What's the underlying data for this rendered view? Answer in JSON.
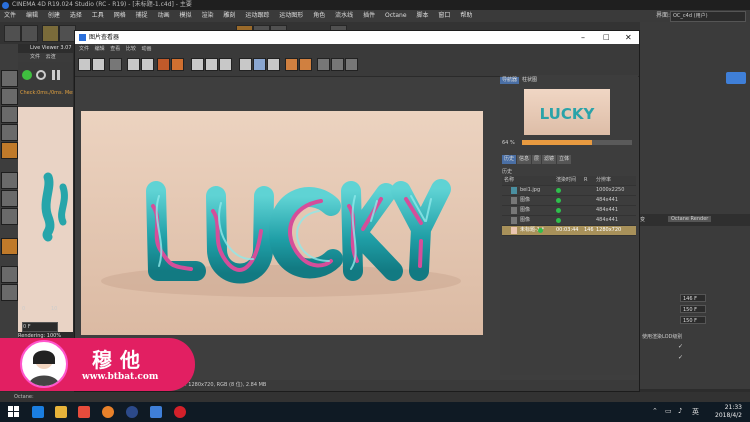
{
  "app": {
    "title": "CINEMA 4D R19.024 Studio (RC - R19) - [未标题-1.c4d] - 主要",
    "layout_label": "界面:",
    "layout_value": "OC_c4d (用户)"
  },
  "menubar": [
    "文件",
    "编辑",
    "创建",
    "选择",
    "工具",
    "网格",
    "捕捉",
    "动画",
    "模拟",
    "渲染",
    "雕刻",
    "运动跟踪",
    "运动图形",
    "角色",
    "流水线",
    "插件",
    "Octane",
    "脚本",
    "窗口",
    "帮助"
  ],
  "live_viewer": {
    "title": "Live Viewer 3.07",
    "menu": [
      "文件",
      "云渲",
      "选项",
      "帮助"
    ],
    "stat": "Check:0ms./0ms. MeshGen:0ms. Update:0ms. Nodes:15 Movable:0",
    "status": "Rendering: 100%  Ms/sec: 0",
    "frame_start": "0",
    "frame_mid": "10",
    "frame_field": "0 F"
  },
  "picture_viewer": {
    "title": "图片查看器",
    "menu": [
      "文件",
      "编辑",
      "查看",
      "比较",
      "动画"
    ],
    "status": "尺寸: 1280x720, RGB (8 位), 2.84 MB",
    "nav_tabs": [
      "导航器",
      "柱状图"
    ],
    "zoom": "64 %",
    "zoom_fraction": 0.64,
    "history_tabs": [
      "历史",
      "信息",
      "层",
      "滤镜",
      "立体"
    ],
    "history_label": "历史",
    "history_headers": [
      "名称",
      "渲染时间",
      "R",
      "分辨率"
    ],
    "history_rows": [
      {
        "name": "bei1.jpg",
        "time": "",
        "r": "",
        "res": "1000x2250"
      },
      {
        "name": "图像",
        "time": "",
        "r": "",
        "res": "484x441"
      },
      {
        "name": "图像",
        "time": "",
        "r": "",
        "res": "484x441"
      },
      {
        "name": "图像",
        "time": "",
        "r": "",
        "res": "484x441"
      },
      {
        "name": "未标题-1 *",
        "time": "00:03:44",
        "r": "146",
        "res": "1280x720"
      }
    ],
    "render_text": "LUCKY",
    "thumb_text": "LUCKY"
  },
  "right_panel": {
    "tabs": [
      "变",
      "Octane Render"
    ],
    "values": [
      "146 F",
      "150 F",
      "150 F"
    ],
    "checkbox_label": "使用渲染LOD级别"
  },
  "status_bar": "Octane:",
  "banner": {
    "name": "穆他",
    "url": "www.btbat.com"
  },
  "clock": {
    "time": "21:33",
    "date": "2018/4/2"
  },
  "ime": "英",
  "colors": {
    "accent": "#e21f62",
    "selected_row": "#a8915a",
    "render_ok": "#2fbf4c",
    "zoom_fill": "#e89a40"
  }
}
